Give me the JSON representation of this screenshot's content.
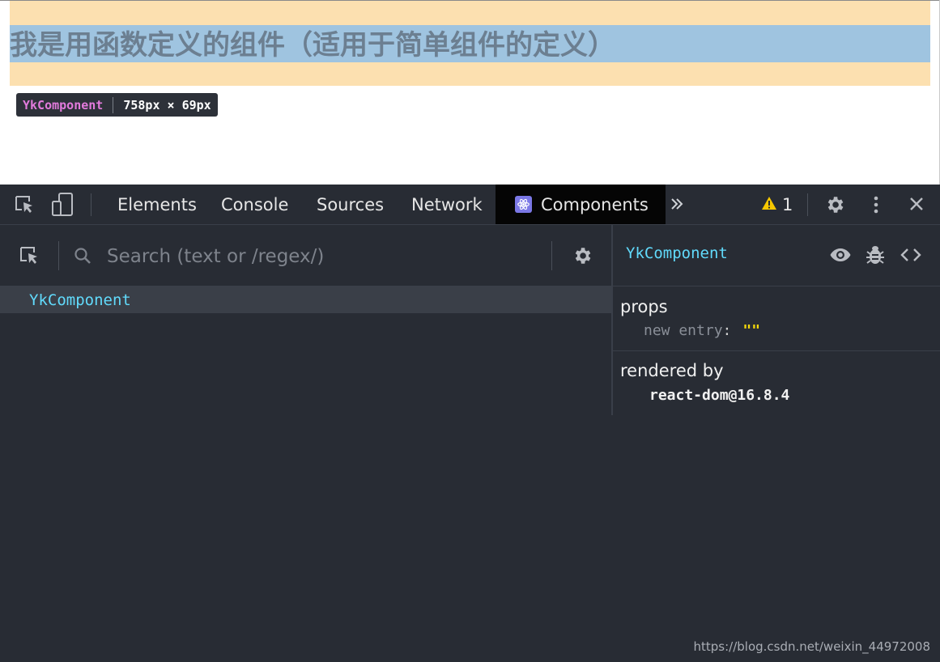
{
  "page": {
    "heading": "我是用函数定义的组件（适用于简单组件的定义）"
  },
  "highlight_tooltip": {
    "component_name": "YkComponent",
    "size": "758px × 69px"
  },
  "devtools": {
    "tabs": [
      {
        "label": "Elements",
        "active": false
      },
      {
        "label": "Console",
        "active": false
      },
      {
        "label": "Sources",
        "active": false
      },
      {
        "label": "Network",
        "active": false
      },
      {
        "label": "Components",
        "active": true
      }
    ],
    "more_tabs_icon": "double-chevron-right-icon",
    "warning_count": "1",
    "colors": {
      "background": "#282c34",
      "active_tab": "#050505",
      "component_name": "#61dafb",
      "warning": "#f6c700",
      "prop_value": "#f5d90a",
      "highlight_margin": "#fce0b0",
      "highlight_content": "#9fc4e0",
      "tooltip_name": "#e27bdc"
    }
  },
  "tree": {
    "search_placeholder": "Search (text or /regex/)",
    "rows": [
      {
        "label": "YkComponent",
        "selected": true
      }
    ]
  },
  "details": {
    "title": "YkComponent",
    "props_label": "props",
    "props": [
      {
        "key": "new entry",
        "value": "\"\""
      }
    ],
    "rendered_by_label": "rendered by",
    "renderer": "react-dom@16.8.4"
  },
  "watermark": "https://blog.csdn.net/weixin_44972008"
}
